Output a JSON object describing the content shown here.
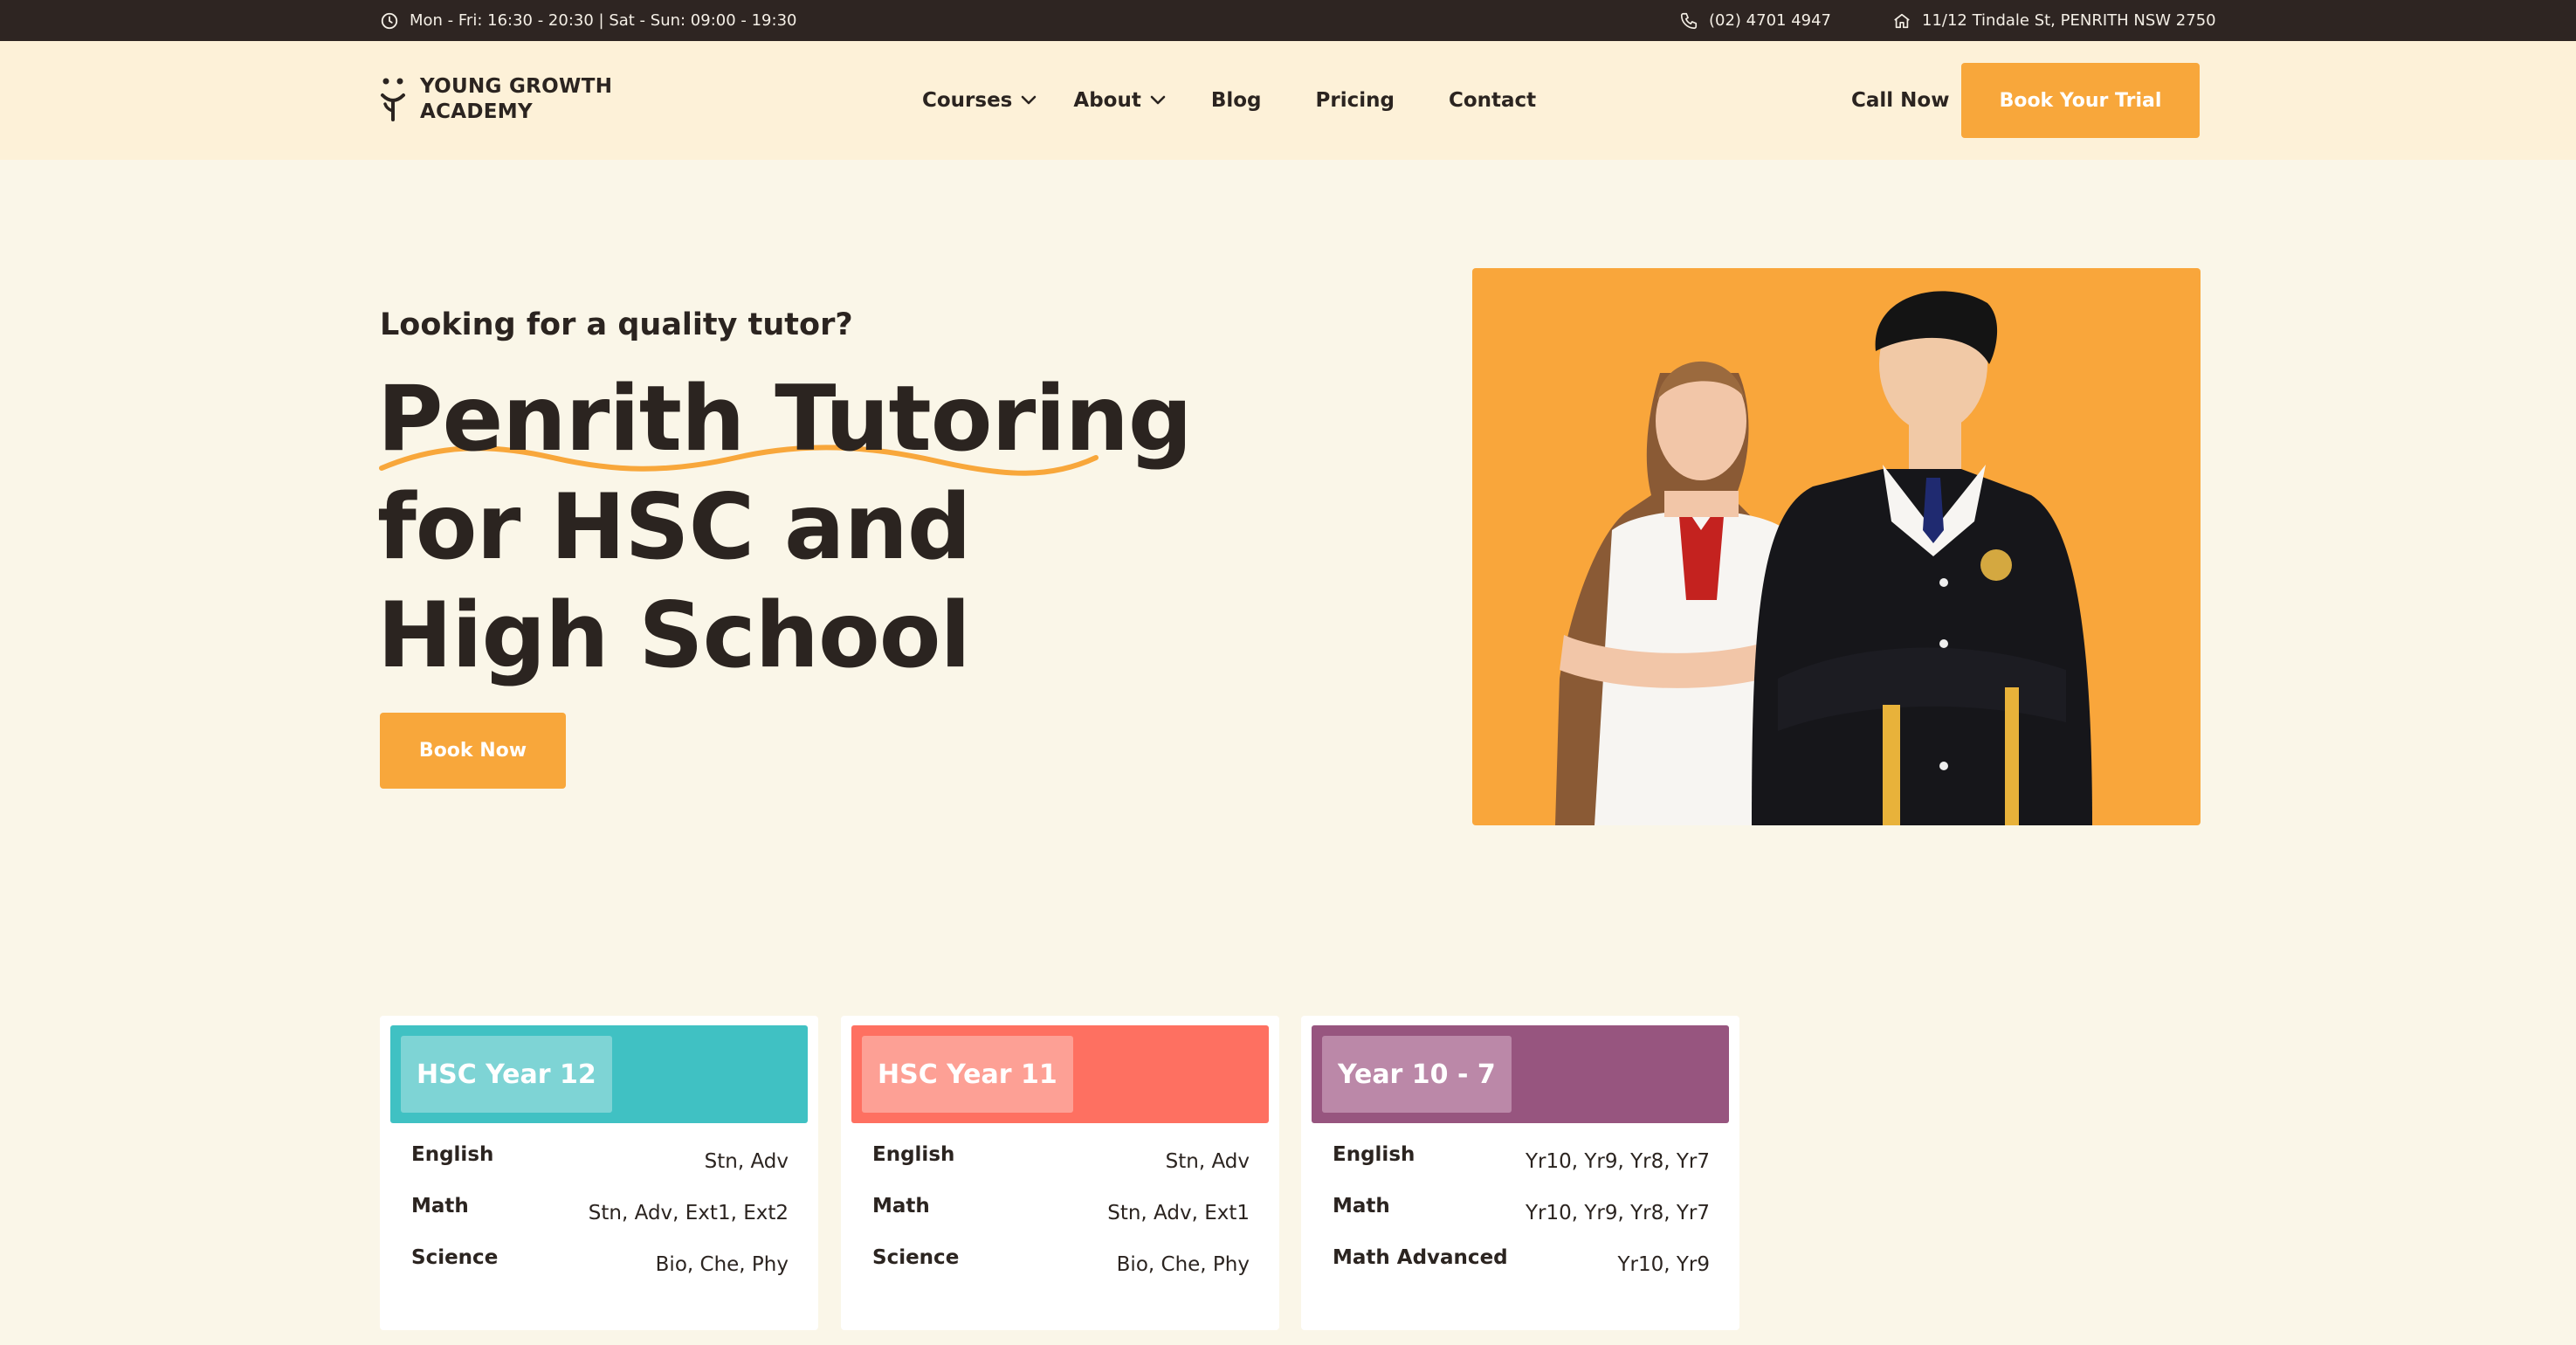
{
  "topbar": {
    "hours": "Mon - Fri: 16:30 - 20:30 | Sat - Sun: 09:00 - 19:30",
    "phone": "(02) 4701 4947",
    "address": "11/12 Tindale St, PENRITH NSW 2750"
  },
  "header": {
    "logo_line1": "YOUNG GROWTH",
    "logo_line2": "ACADEMY",
    "nav": {
      "courses": "Courses",
      "about": "About",
      "blog": "Blog",
      "pricing": "Pricing",
      "contact": "Contact"
    },
    "call_now": "Call Now",
    "trial_button": "Book Your Trial"
  },
  "hero": {
    "eyebrow": "Looking for a quality tutor?",
    "title_line1": "Penrith Tutoring",
    "title_line2": "for HSC and",
    "title_line3": "High School",
    "button": "Book Now",
    "colors": {
      "accent": "#f8a73b",
      "dark": "#2e2522",
      "background": "#faf6e8",
      "header_bg": "#fdf1d8"
    }
  },
  "cards": [
    {
      "title": "HSC Year 12",
      "color": "#40c1c3",
      "pill_color": "#7ed4d5",
      "rows": [
        {
          "subject": "English",
          "levels": "Stn, Adv"
        },
        {
          "subject": "Math",
          "levels": "Stn, Adv, Ext1, Ext2"
        },
        {
          "subject": "Science",
          "levels": "Bio, Che, Phy"
        }
      ]
    },
    {
      "title": "HSC Year 11",
      "color": "#fe7061",
      "pill_color": "#fda095",
      "rows": [
        {
          "subject": "English",
          "levels": "Stn, Adv"
        },
        {
          "subject": "Math",
          "levels": "Stn, Adv, Ext1"
        },
        {
          "subject": "Science",
          "levels": "Bio, Che, Phy"
        }
      ]
    },
    {
      "title": "Year 10 - 7",
      "color": "#97557f",
      "pill_color": "#bb88a8",
      "rows": [
        {
          "subject": "English",
          "levels": "Yr10, Yr9, Yr8, Yr7"
        },
        {
          "subject": "Math",
          "levels": "Yr10, Yr9, Yr8, Yr7"
        },
        {
          "subject": "Math Advanced",
          "levels": "Yr10, Yr9"
        }
      ]
    }
  ],
  "icons": [
    "clock-icon",
    "phone-icon",
    "home-icon",
    "chevron-down-icon",
    "logo-icon"
  ]
}
